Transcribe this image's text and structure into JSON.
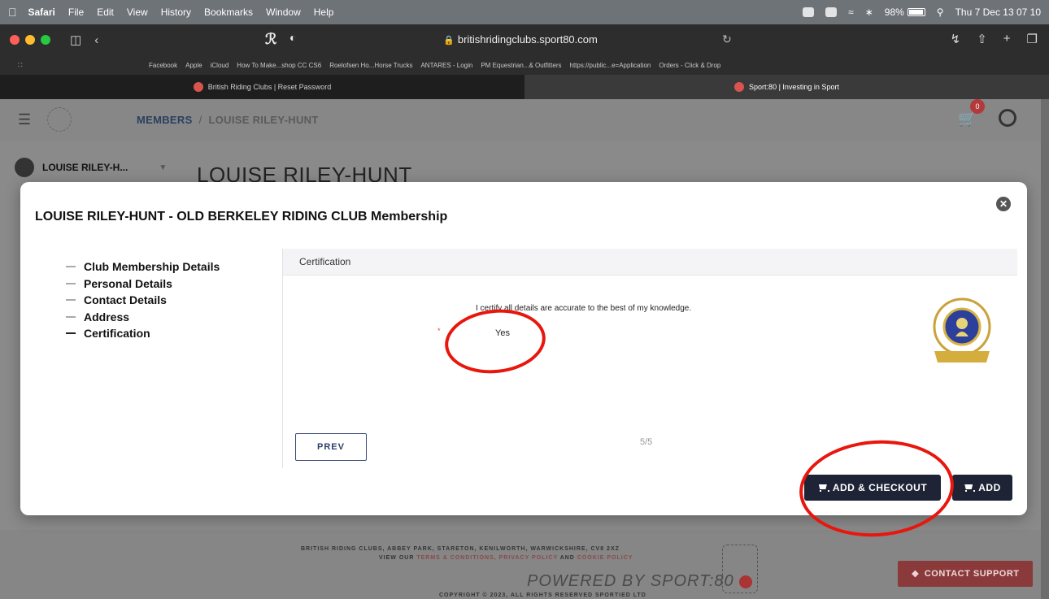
{
  "menubar": {
    "app": "Safari",
    "items": [
      "File",
      "Edit",
      "View",
      "History",
      "Bookmarks",
      "Window",
      "Help"
    ],
    "battery": "98%",
    "clock": "Thu 7 Dec  13 07 10"
  },
  "browser": {
    "url": "britishridingclubs.sport80.com",
    "favorites": [
      "Facebook",
      "Apple",
      "iCloud",
      "How To Make...shop CC CS6",
      "Roelofsen Ho...Horse Trucks",
      "ANTARES - Login",
      "PM Equestrian...& Outfitters",
      "https://public...e=Application",
      "Orders - Click & Drop"
    ],
    "tabs": [
      {
        "label": "British Riding Clubs | Reset Password"
      },
      {
        "label": "Sport:80 | Investing in Sport"
      }
    ]
  },
  "header": {
    "breadcrumb_root": "MEMBERS",
    "breadcrumb_sep": "/",
    "breadcrumb_current": "LOUISE RILEY-HUNT",
    "cart_count": "0"
  },
  "member": {
    "selector_label": "LOUISE RILEY-H...",
    "title": "LOUISE RILEY-HUNT"
  },
  "modal": {
    "title": "LOUISE RILEY-HUNT - OLD BERKELEY RIDING CLUB Membership",
    "steps": [
      {
        "label": "Club Membership Details"
      },
      {
        "label": "Personal Details"
      },
      {
        "label": "Contact Details"
      },
      {
        "label": "Address"
      },
      {
        "label": "Certification"
      }
    ],
    "panel_title": "Certification",
    "certify_text": "I certify all details are accurate to the best of my knowledge.",
    "required_mark": "*",
    "answer": "Yes",
    "prev_label": "PREV",
    "pager": "5/5",
    "add_checkout_label": "ADD & CHECKOUT",
    "add_label": "ADD"
  },
  "footer": {
    "address": "BRITISH RIDING CLUBS, ABBEY PARK, STARETON, KENILWORTH, WARWICKSHIRE, CV8 2XZ",
    "view_our": "VIEW OUR",
    "terms": "TERMS & CONDITIONS,",
    "privacy": "PRIVACY POLICY",
    "and": "AND",
    "cookie": "COOKIE POLICY",
    "powered": "POWERED BY SPORT:80",
    "copyright": "COPYRIGHT © 2023, ALL RIGHTS RESERVED SPORTIED LTD",
    "contact_support": "CONTACT SUPPORT"
  },
  "colors": {
    "annotation": "#e8160c",
    "primary_button": "#1e2435",
    "support_button": "#8a3a3a"
  },
  "icons": [
    "apple-icon",
    "wifi-icon",
    "bluetooth-icon",
    "search-icon",
    "cart-icon",
    "user-icon",
    "close-icon",
    "lock-icon",
    "reload-icon"
  ]
}
